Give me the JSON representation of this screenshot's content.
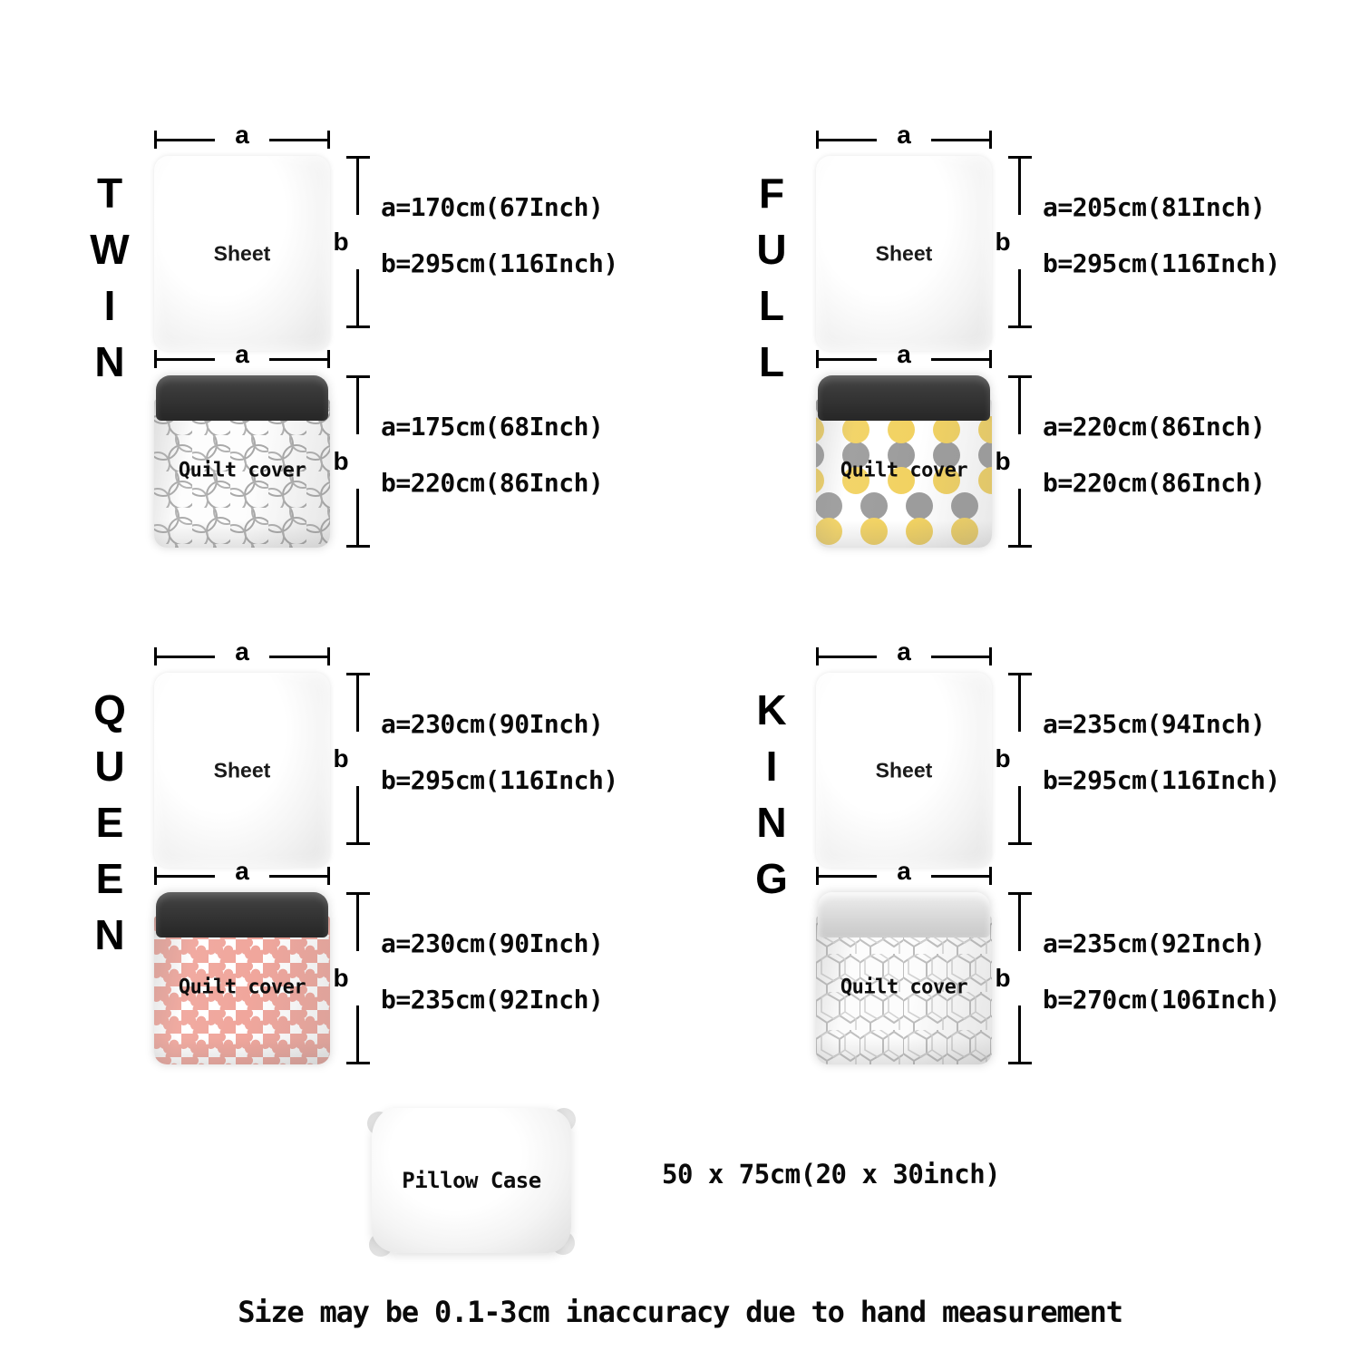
{
  "colors": {
    "pattern_grey": "#9c9c9c",
    "pattern_yellow": "#f2d261",
    "pattern_pink": "#f0a69c",
    "pillow_dark": "#333333",
    "pillow_light": "#dcdcdc",
    "text": "#0a0a0a"
  },
  "sizes": [
    {
      "id": "twin",
      "name": "TWIN",
      "letters": [
        "T",
        "W",
        "I",
        "N"
      ],
      "sheet": {
        "label": "Sheet",
        "dim_a_label": "a",
        "dim_b_label": "b",
        "measure_a": "a=170cm(67Inch)",
        "measure_b": "b=295cm(116Inch)"
      },
      "quilt": {
        "label": "Quilt cover",
        "dim_a_label": "a",
        "dim_b_label": "b",
        "measure_a": "a=175cm(68Inch)",
        "measure_b": "b=220cm(86Inch)",
        "pattern": "grey-circles",
        "pillow_tone": "dark"
      }
    },
    {
      "id": "full",
      "name": "FULL",
      "letters": [
        "F",
        "U",
        "L",
        "L"
      ],
      "sheet": {
        "label": "Sheet",
        "dim_a_label": "a",
        "dim_b_label": "b",
        "measure_a": "a=205cm(81Inch)",
        "measure_b": "b=295cm(116Inch)"
      },
      "quilt": {
        "label": "Quilt cover",
        "dim_a_label": "a",
        "dim_b_label": "b",
        "measure_a": "a=220cm(86Inch)",
        "measure_b": "b=220cm(86Inch)",
        "pattern": "polka-dots",
        "pillow_tone": "dark"
      }
    },
    {
      "id": "queen",
      "name": "QUEEN",
      "letters": [
        "Q",
        "U",
        "E",
        "E",
        "N"
      ],
      "sheet": {
        "label": "Sheet",
        "dim_a_label": "a",
        "dim_b_label": "b",
        "measure_a": "a=230cm(90Inch)",
        "measure_b": "b=295cm(116Inch)"
      },
      "quilt": {
        "label": "Quilt cover",
        "dim_a_label": "a",
        "dim_b_label": "b",
        "measure_a": "a=230cm(90Inch)",
        "measure_b": "b=235cm(92Inch)",
        "pattern": "pink-stars",
        "pillow_tone": "dark"
      }
    },
    {
      "id": "king",
      "name": "KING",
      "letters": [
        "K",
        "I",
        "N",
        "G"
      ],
      "sheet": {
        "label": "Sheet",
        "dim_a_label": "a",
        "dim_b_label": "b",
        "measure_a": "a=235cm(94Inch)",
        "measure_b": "b=295cm(116Inch)"
      },
      "quilt": {
        "label": "Quilt cover",
        "dim_a_label": "a",
        "dim_b_label": "b",
        "measure_a": "a=235cm(92Inch)",
        "measure_b": "b=270cm(106Inch)",
        "pattern": "geometric-lines",
        "pillow_tone": "light"
      }
    }
  ],
  "pillowcase": {
    "label": "Pillow Case",
    "measure": "50 x 75cm(20 x 30inch)"
  },
  "disclaimer": "Size may be 0.1-3cm inaccuracy due to hand measurement"
}
